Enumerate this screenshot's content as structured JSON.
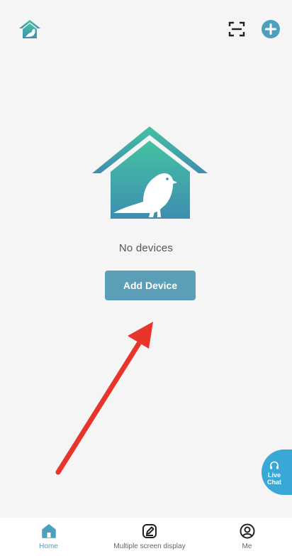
{
  "header": {
    "home_icon": "bird-house-icon",
    "scan_icon": "scan-icon",
    "add_icon": "plus-circle-icon"
  },
  "main": {
    "illustration": "bird-house-illustration",
    "empty_text": "No devices",
    "add_device_label": "Add Device"
  },
  "live_chat": {
    "line1": "Live",
    "line2": "Chat",
    "icon": "headset-icon"
  },
  "tabs": [
    {
      "label": "Home",
      "icon": "home-icon",
      "active": true
    },
    {
      "label": "Multiple screen display",
      "icon": "edit-icon",
      "active": false
    },
    {
      "label": "Me",
      "icon": "user-icon",
      "active": false
    }
  ],
  "colors": {
    "accent": "#5a9fb7",
    "teal_light": "#44c2a2",
    "teal_dark": "#3f8eb0",
    "annotation_arrow": "#e8352b",
    "live_chat": "#3aa8d6",
    "active_tab": "#4d9fc0"
  }
}
